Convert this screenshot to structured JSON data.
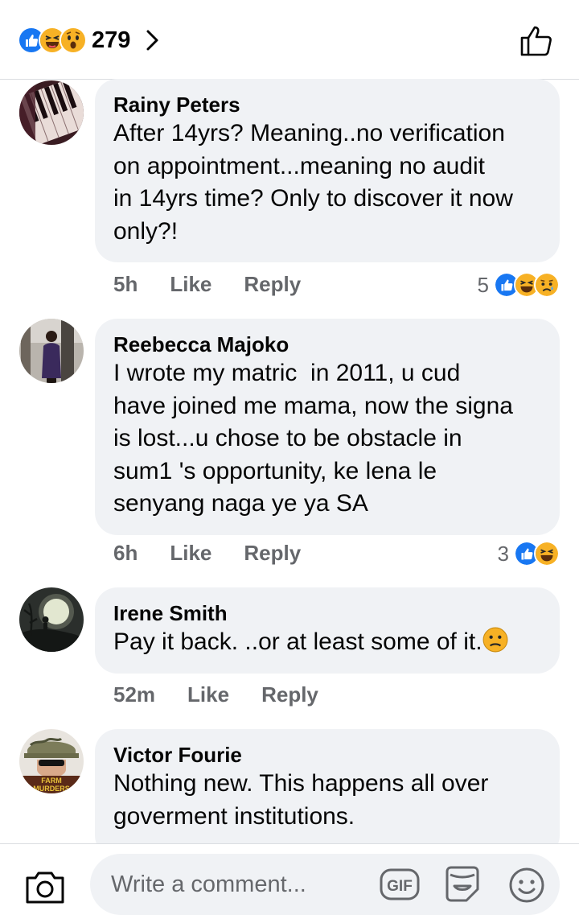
{
  "header": {
    "reaction_count": "279",
    "reactions": [
      "like-icon",
      "haha-icon",
      "wow-icon"
    ]
  },
  "comments": [
    {
      "author": "Rainy Peters",
      "text": "After 14yrs? Meaning..no verification\non appointment...meaning no audit\nin 14yrs time? Only to discover it now\nonly?!",
      "time": "5h",
      "like_label": "Like",
      "reply_label": "Reply",
      "reaction_count": "5",
      "reactions": [
        "like-icon",
        "haha-icon",
        "sad-icon"
      ]
    },
    {
      "author": "Reebecca Majoko",
      "text": "I wrote my matric  in 2011, u cud\nhave joined me mama, now the signa\nis lost...u chose to be obstacle in\nsum1 's opportunity, ke lena le\nsenyang naga ye ya SA",
      "time": "6h",
      "like_label": "Like",
      "reply_label": "Reply",
      "reaction_count": "3",
      "reactions": [
        "like-icon",
        "haha-icon"
      ]
    },
    {
      "author": "Irene Smith",
      "text": "Pay it back. ..or at least some of it.",
      "time": "52m",
      "like_label": "Like",
      "reply_label": "Reply"
    },
    {
      "author": "Victor Fourie",
      "text": "Nothing new. This happens all over\ngoverment institutions.",
      "avatar_caption": "FARM\nMURDERS"
    }
  ],
  "composer": {
    "placeholder": "Write a comment...",
    "gif_label": "GIF"
  },
  "colors": {
    "like_blue": "#1877f2",
    "emoji_yellow": "#f7b125",
    "meta_gray": "#65676b",
    "bubble_gray": "#f0f2f5"
  }
}
